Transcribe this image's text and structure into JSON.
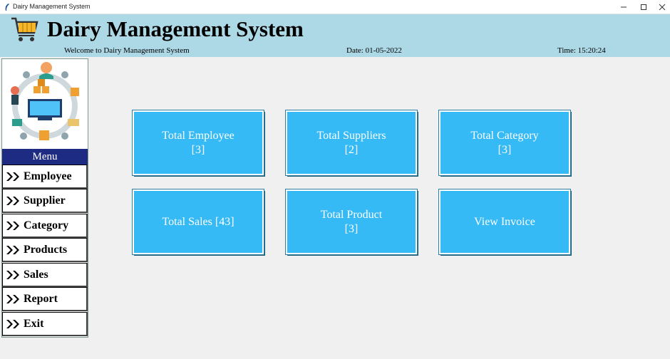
{
  "window": {
    "title": "Dairy Management System"
  },
  "header": {
    "title": "Dairy Management System",
    "welcome": "Welcome to Dairy Management System",
    "date": "Date: 01-05-2022",
    "time": "Time: 15:20:24"
  },
  "sidebar": {
    "menu_label": "Menu",
    "items": [
      {
        "label": "Employee",
        "icon": "double-chevron-icon"
      },
      {
        "label": "Supplier",
        "icon": "double-chevron-icon"
      },
      {
        "label": "Category",
        "icon": "double-chevron-icon"
      },
      {
        "label": "Products",
        "icon": "double-chevron-icon"
      },
      {
        "label": "Sales",
        "icon": "double-chevron-icon"
      },
      {
        "label": "Report",
        "icon": "double-chevron-icon"
      },
      {
        "label": "Exit",
        "icon": "double-chevron-icon"
      }
    ]
  },
  "tiles": [
    {
      "line1": "Total Employee",
      "line2": "[3]"
    },
    {
      "line1": "Total Suppliers",
      "line2": "[2]"
    },
    {
      "line1": "Total Category",
      "line2": "[3]"
    },
    {
      "line1": "Total Sales [43]",
      "line2": ""
    },
    {
      "line1": "Total Product",
      "line2": "[3]"
    },
    {
      "line1": "View Invoice",
      "line2": ""
    }
  ],
  "colors": {
    "header": "#add8e6",
    "tile": "#35baf6",
    "menu_header": "#1e2b82"
  }
}
